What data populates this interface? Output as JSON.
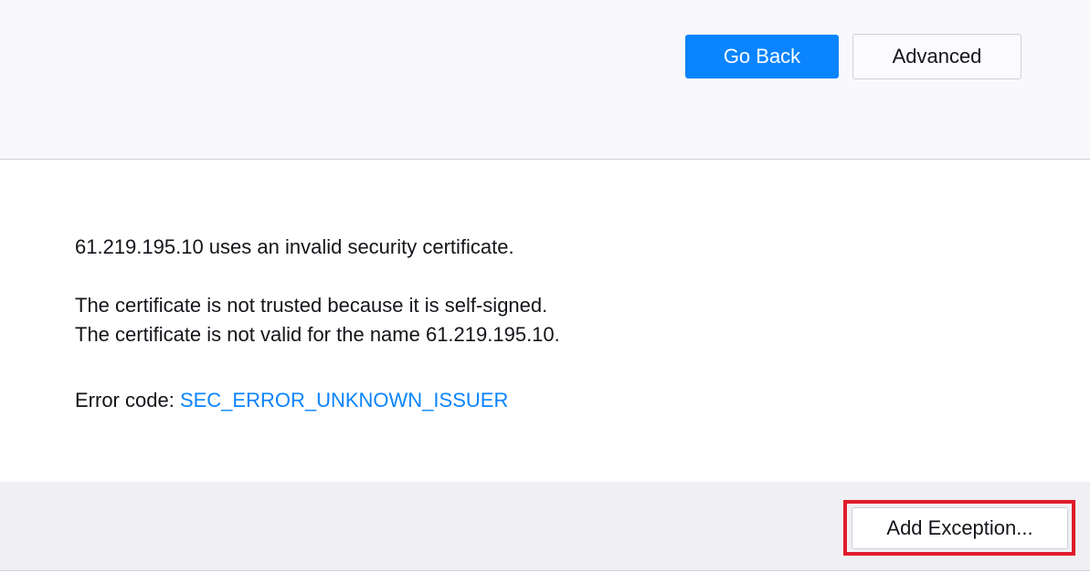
{
  "header": {
    "go_back_label": "Go Back",
    "advanced_label": "Advanced"
  },
  "details": {
    "invalid_certificate_text": "61.219.195.10 uses an invalid security certificate.",
    "self_signed_text": "The certificate is not trusted because it is self-signed.",
    "name_mismatch_text": "The certificate is not valid for the name 61.219.195.10.",
    "error_code_label": "Error code: ",
    "error_code_value": "SEC_ERROR_UNKNOWN_ISSUER"
  },
  "footer": {
    "add_exception_label": "Add Exception..."
  },
  "colors": {
    "accent": "#0a84ff",
    "highlight": "#e01b2b",
    "top_panel_bg": "#f9f9fb",
    "bottom_panel_bg": "#f0f0f4"
  }
}
